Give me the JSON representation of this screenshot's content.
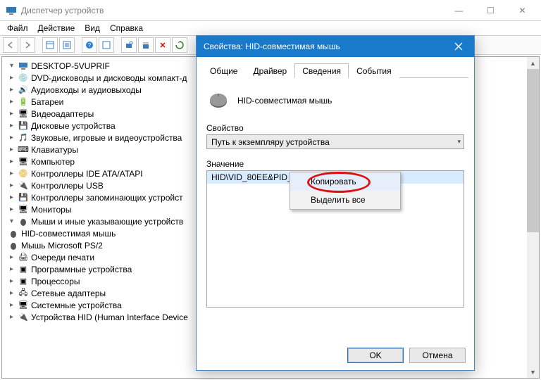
{
  "window": {
    "title": "Диспетчер устройств",
    "btn_min": "—",
    "btn_max": "☐",
    "btn_close": "✕"
  },
  "menu": {
    "file": "Файл",
    "action": "Действие",
    "view": "Вид",
    "help": "Справка"
  },
  "tree": {
    "root": "DESKTOP-5VUPRIF",
    "items": [
      "DVD-дисководы и дисководы компакт-д",
      "Аудиовходы и аудиовыходы",
      "Батареи",
      "Видеоадаптеры",
      "Дисковые устройства",
      "Звуковые, игровые и видеоустройства",
      "Клавиатуры",
      "Компьютер",
      "Контроллеры IDE ATA/ATAPI",
      "Контроллеры USB",
      "Контроллеры запоминающих устройст",
      "Мониторы"
    ],
    "expanded_label": "Мыши и иные указывающие устройств",
    "children": [
      "HID-совместимая мышь",
      "Мышь Microsoft PS/2"
    ],
    "items2": [
      "Очереди печати",
      "Программные устройства",
      "Процессоры",
      "Сетевые адаптеры",
      "Системные устройства",
      "Устройства HID (Human Interface Device"
    ]
  },
  "dialog": {
    "title": "Свойства: HID-совместимая мышь",
    "tabs": {
      "general": "Общие",
      "driver": "Драйвер",
      "details": "Сведения",
      "events": "События"
    },
    "device_name": "HID-совместимая мышь",
    "property_label": "Свойство",
    "property_value": "Путь к экземпляру устройства",
    "value_label": "Значение",
    "value_text": "HID\\VID_80EE&PID_0021\\6&E3985F7&0&0000",
    "ok": "OK",
    "cancel": "Отмена"
  },
  "ctx": {
    "copy": "Копировать",
    "select_all": "Выделить все"
  }
}
